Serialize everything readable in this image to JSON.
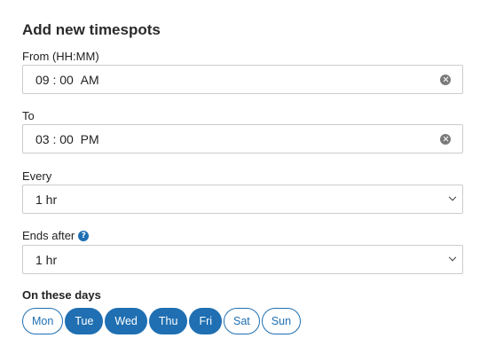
{
  "title": "Add new timespots",
  "from": {
    "label": "From (HH:MM)",
    "hours": "09",
    "minutes": "00",
    "period": "AM"
  },
  "to": {
    "label": "To",
    "hours": "03",
    "minutes": "00",
    "period": "PM"
  },
  "every": {
    "label": "Every",
    "value": "1 hr"
  },
  "ends_after": {
    "label": "Ends after",
    "help_glyph": "?",
    "value": "1 hr"
  },
  "days": {
    "label": "On these days",
    "items": [
      {
        "label": "Mon",
        "selected": false
      },
      {
        "label": "Tue",
        "selected": true
      },
      {
        "label": "Wed",
        "selected": true
      },
      {
        "label": "Thu",
        "selected": true
      },
      {
        "label": "Fri",
        "selected": true
      },
      {
        "label": "Sat",
        "selected": false
      },
      {
        "label": "Sun",
        "selected": false
      }
    ]
  },
  "colors": {
    "accent": "#1f6fb2",
    "border": "#cccccc",
    "clear_icon": "#7a7a7a"
  }
}
